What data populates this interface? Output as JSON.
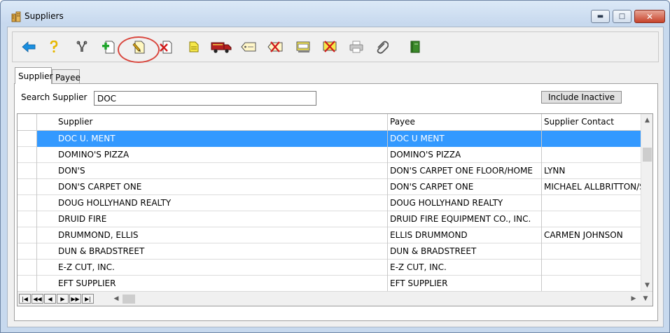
{
  "window": {
    "title": "Suppliers"
  },
  "toolbar": {
    "icons": [
      "back-arrow-icon",
      "help-icon",
      "tools-icon",
      "add-supplier-icon",
      "edit-supplier-icon",
      "delete-supplier-icon",
      "note-icon",
      "truck-icon",
      "tag-icon",
      "remove-tag-icon",
      "label-icon",
      "remove-label-icon",
      "print-icon",
      "attachment-icon",
      "book-icon"
    ],
    "highlight_color": "#d9473e"
  },
  "tabs": [
    {
      "label": "Supplier",
      "active": true
    },
    {
      "label": "Payee",
      "active": false
    }
  ],
  "search": {
    "label": "Search Supplier",
    "value": "DOC"
  },
  "include_inactive_label": "Include Inactive",
  "grid": {
    "columns": [
      "Supplier",
      "Payee",
      "Supplier Contact"
    ],
    "selected_color": "#3399ff",
    "rows": [
      {
        "supplier": "DOC U. MENT",
        "payee": "DOC U MENT",
        "contact": "",
        "selected": true
      },
      {
        "supplier": "DOMINO'S PIZZA",
        "payee": "DOMINO'S PIZZA",
        "contact": ""
      },
      {
        "supplier": "DON'S",
        "payee": "DON'S CARPET ONE FLOOR/HOME",
        "contact": "LYNN"
      },
      {
        "supplier": "DON'S CARPET ONE",
        "payee": "DON'S CARPET ONE",
        "contact": "MICHAEL ALLBRITTON/ST"
      },
      {
        "supplier": "DOUG HOLLYHAND REALTY",
        "payee": "DOUG HOLLYHAND REALTY",
        "contact": ""
      },
      {
        "supplier": "DRUID FIRE",
        "payee": "DRUID FIRE EQUIPMENT CO., INC.",
        "contact": ""
      },
      {
        "supplier": "DRUMMOND, ELLIS",
        "payee": "ELLIS DRUMMOND",
        "contact": "CARMEN JOHNSON"
      },
      {
        "supplier": "DUN & BRADSTREET",
        "payee": "DUN & BRADSTREET",
        "contact": ""
      },
      {
        "supplier": "E-Z CUT, INC.",
        "payee": "E-Z CUT, INC.",
        "contact": ""
      },
      {
        "supplier": "EFT SUPPLIER",
        "payee": "EFT SUPPLIER",
        "contact": ""
      }
    ]
  },
  "nav": {
    "buttons": [
      "first",
      "prev-page",
      "prev",
      "next",
      "next-page",
      "last"
    ]
  }
}
